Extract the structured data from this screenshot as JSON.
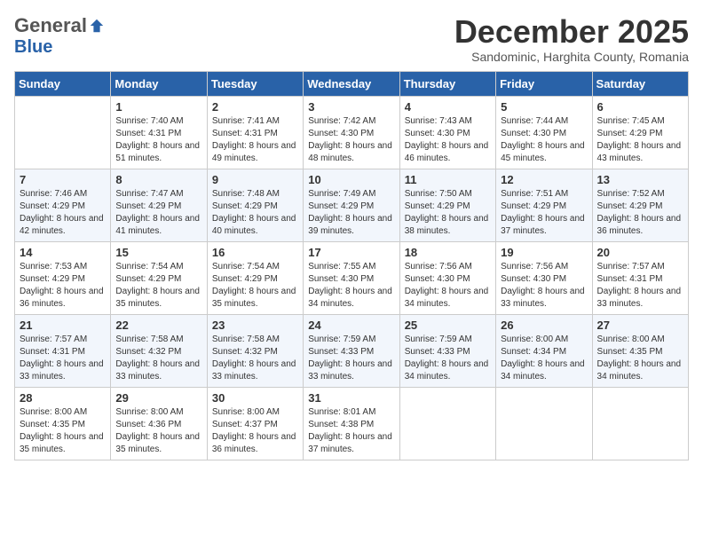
{
  "logo": {
    "general": "General",
    "blue": "Blue"
  },
  "title": "December 2025",
  "subtitle": "Sandominic, Harghita County, Romania",
  "days_of_week": [
    "Sunday",
    "Monday",
    "Tuesday",
    "Wednesday",
    "Thursday",
    "Friday",
    "Saturday"
  ],
  "weeks": [
    [
      {
        "day": "",
        "sunrise": "",
        "sunset": "",
        "daylight": ""
      },
      {
        "day": "1",
        "sunrise": "Sunrise: 7:40 AM",
        "sunset": "Sunset: 4:31 PM",
        "daylight": "Daylight: 8 hours and 51 minutes."
      },
      {
        "day": "2",
        "sunrise": "Sunrise: 7:41 AM",
        "sunset": "Sunset: 4:31 PM",
        "daylight": "Daylight: 8 hours and 49 minutes."
      },
      {
        "day": "3",
        "sunrise": "Sunrise: 7:42 AM",
        "sunset": "Sunset: 4:30 PM",
        "daylight": "Daylight: 8 hours and 48 minutes."
      },
      {
        "day": "4",
        "sunrise": "Sunrise: 7:43 AM",
        "sunset": "Sunset: 4:30 PM",
        "daylight": "Daylight: 8 hours and 46 minutes."
      },
      {
        "day": "5",
        "sunrise": "Sunrise: 7:44 AM",
        "sunset": "Sunset: 4:30 PM",
        "daylight": "Daylight: 8 hours and 45 minutes."
      },
      {
        "day": "6",
        "sunrise": "Sunrise: 7:45 AM",
        "sunset": "Sunset: 4:29 PM",
        "daylight": "Daylight: 8 hours and 43 minutes."
      }
    ],
    [
      {
        "day": "7",
        "sunrise": "Sunrise: 7:46 AM",
        "sunset": "Sunset: 4:29 PM",
        "daylight": "Daylight: 8 hours and 42 minutes."
      },
      {
        "day": "8",
        "sunrise": "Sunrise: 7:47 AM",
        "sunset": "Sunset: 4:29 PM",
        "daylight": "Daylight: 8 hours and 41 minutes."
      },
      {
        "day": "9",
        "sunrise": "Sunrise: 7:48 AM",
        "sunset": "Sunset: 4:29 PM",
        "daylight": "Daylight: 8 hours and 40 minutes."
      },
      {
        "day": "10",
        "sunrise": "Sunrise: 7:49 AM",
        "sunset": "Sunset: 4:29 PM",
        "daylight": "Daylight: 8 hours and 39 minutes."
      },
      {
        "day": "11",
        "sunrise": "Sunrise: 7:50 AM",
        "sunset": "Sunset: 4:29 PM",
        "daylight": "Daylight: 8 hours and 38 minutes."
      },
      {
        "day": "12",
        "sunrise": "Sunrise: 7:51 AM",
        "sunset": "Sunset: 4:29 PM",
        "daylight": "Daylight: 8 hours and 37 minutes."
      },
      {
        "day": "13",
        "sunrise": "Sunrise: 7:52 AM",
        "sunset": "Sunset: 4:29 PM",
        "daylight": "Daylight: 8 hours and 36 minutes."
      }
    ],
    [
      {
        "day": "14",
        "sunrise": "Sunrise: 7:53 AM",
        "sunset": "Sunset: 4:29 PM",
        "daylight": "Daylight: 8 hours and 36 minutes."
      },
      {
        "day": "15",
        "sunrise": "Sunrise: 7:54 AM",
        "sunset": "Sunset: 4:29 PM",
        "daylight": "Daylight: 8 hours and 35 minutes."
      },
      {
        "day": "16",
        "sunrise": "Sunrise: 7:54 AM",
        "sunset": "Sunset: 4:29 PM",
        "daylight": "Daylight: 8 hours and 35 minutes."
      },
      {
        "day": "17",
        "sunrise": "Sunrise: 7:55 AM",
        "sunset": "Sunset: 4:30 PM",
        "daylight": "Daylight: 8 hours and 34 minutes."
      },
      {
        "day": "18",
        "sunrise": "Sunrise: 7:56 AM",
        "sunset": "Sunset: 4:30 PM",
        "daylight": "Daylight: 8 hours and 34 minutes."
      },
      {
        "day": "19",
        "sunrise": "Sunrise: 7:56 AM",
        "sunset": "Sunset: 4:30 PM",
        "daylight": "Daylight: 8 hours and 33 minutes."
      },
      {
        "day": "20",
        "sunrise": "Sunrise: 7:57 AM",
        "sunset": "Sunset: 4:31 PM",
        "daylight": "Daylight: 8 hours and 33 minutes."
      }
    ],
    [
      {
        "day": "21",
        "sunrise": "Sunrise: 7:57 AM",
        "sunset": "Sunset: 4:31 PM",
        "daylight": "Daylight: 8 hours and 33 minutes."
      },
      {
        "day": "22",
        "sunrise": "Sunrise: 7:58 AM",
        "sunset": "Sunset: 4:32 PM",
        "daylight": "Daylight: 8 hours and 33 minutes."
      },
      {
        "day": "23",
        "sunrise": "Sunrise: 7:58 AM",
        "sunset": "Sunset: 4:32 PM",
        "daylight": "Daylight: 8 hours and 33 minutes."
      },
      {
        "day": "24",
        "sunrise": "Sunrise: 7:59 AM",
        "sunset": "Sunset: 4:33 PM",
        "daylight": "Daylight: 8 hours and 33 minutes."
      },
      {
        "day": "25",
        "sunrise": "Sunrise: 7:59 AM",
        "sunset": "Sunset: 4:33 PM",
        "daylight": "Daylight: 8 hours and 34 minutes."
      },
      {
        "day": "26",
        "sunrise": "Sunrise: 8:00 AM",
        "sunset": "Sunset: 4:34 PM",
        "daylight": "Daylight: 8 hours and 34 minutes."
      },
      {
        "day": "27",
        "sunrise": "Sunrise: 8:00 AM",
        "sunset": "Sunset: 4:35 PM",
        "daylight": "Daylight: 8 hours and 34 minutes."
      }
    ],
    [
      {
        "day": "28",
        "sunrise": "Sunrise: 8:00 AM",
        "sunset": "Sunset: 4:35 PM",
        "daylight": "Daylight: 8 hours and 35 minutes."
      },
      {
        "day": "29",
        "sunrise": "Sunrise: 8:00 AM",
        "sunset": "Sunset: 4:36 PM",
        "daylight": "Daylight: 8 hours and 35 minutes."
      },
      {
        "day": "30",
        "sunrise": "Sunrise: 8:00 AM",
        "sunset": "Sunset: 4:37 PM",
        "daylight": "Daylight: 8 hours and 36 minutes."
      },
      {
        "day": "31",
        "sunrise": "Sunrise: 8:01 AM",
        "sunset": "Sunset: 4:38 PM",
        "daylight": "Daylight: 8 hours and 37 minutes."
      },
      {
        "day": "",
        "sunrise": "",
        "sunset": "",
        "daylight": ""
      },
      {
        "day": "",
        "sunrise": "",
        "sunset": "",
        "daylight": ""
      },
      {
        "day": "",
        "sunrise": "",
        "sunset": "",
        "daylight": ""
      }
    ]
  ]
}
